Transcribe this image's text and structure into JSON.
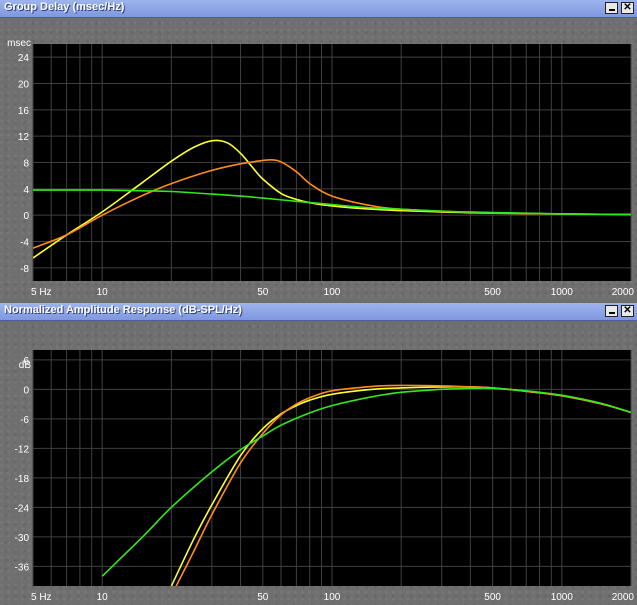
{
  "panels": [
    {
      "title": "Group Delay (msec/Hz)",
      "window_buttons": {
        "minimize_icon": "minimize-icon",
        "close_icon": "close-icon",
        "close_label": "✕"
      }
    },
    {
      "title": "Normalized Amplitude Response (dB-SPL/Hz)",
      "window_buttons": {
        "minimize_icon": "minimize-icon",
        "close_icon": "close-icon",
        "close_label": "✕"
      }
    }
  ],
  "colors": {
    "background": "#000000",
    "grid": "#404040",
    "series1": "#ffff33",
    "series2": "#ff8c1a",
    "series3": "#33e81a"
  },
  "chart_data": [
    {
      "type": "line",
      "title": "Group Delay (msec/Hz)",
      "ylabel": "msec",
      "xscale": "log",
      "xlim": [
        5,
        2000
      ],
      "ylim": [
        -10,
        26
      ],
      "x_ticks": [
        5,
        10,
        50,
        100,
        500,
        1000,
        2000
      ],
      "x_tick_labels": [
        "5 Hz",
        "10",
        "50",
        "100",
        "500",
        "1000",
        "2000"
      ],
      "y_ticks": [
        -8,
        -4,
        0,
        4,
        8,
        12,
        16,
        20,
        24
      ],
      "y_tick_labels": [
        "-8",
        "-4",
        "0",
        "4",
        "8",
        "12",
        "16",
        "20",
        "24"
      ],
      "grid": true,
      "series": [
        {
          "color": "#ffff33",
          "x": [
            5,
            7,
            10,
            15,
            20,
            25,
            30,
            35,
            40,
            45,
            50,
            60,
            70,
            80,
            100,
            150,
            200,
            300,
            500,
            1000,
            2000
          ],
          "y": [
            -6.5,
            -3,
            0.5,
            5,
            8.2,
            10.3,
            11.3,
            11,
            9.4,
            7.3,
            5.5,
            3.3,
            2.4,
            1.9,
            1.4,
            0.9,
            0.7,
            0.5,
            0.3,
            0.2,
            0.1
          ]
        },
        {
          "color": "#ff8c1a",
          "x": [
            5,
            7,
            10,
            15,
            20,
            30,
            40,
            50,
            55,
            60,
            70,
            80,
            100,
            150,
            200,
            300,
            500,
            1000,
            2000
          ],
          "y": [
            -5,
            -3,
            0,
            3,
            4.8,
            6.8,
            7.8,
            8.3,
            8.4,
            8.1,
            6.6,
            4.8,
            2.9,
            1.4,
            0.9,
            0.6,
            0.3,
            0.2,
            0.1
          ]
        },
        {
          "color": "#33e81a",
          "x": [
            5,
            10,
            15,
            20,
            30,
            40,
            50,
            70,
            100,
            150,
            200,
            300,
            500,
            1000,
            2000
          ],
          "y": [
            3.8,
            3.8,
            3.7,
            3.6,
            3.2,
            2.9,
            2.6,
            2.1,
            1.6,
            1.1,
            0.9,
            0.6,
            0.4,
            0.2,
            0.1
          ]
        }
      ]
    },
    {
      "type": "line",
      "title": "Normalized Amplitude Response (dB-SPL/Hz)",
      "ylabel": "dB",
      "xscale": "log",
      "xlim": [
        5,
        2000
      ],
      "ylim": [
        -40,
        8
      ],
      "x_ticks": [
        5,
        10,
        50,
        100,
        500,
        1000,
        2000
      ],
      "x_tick_labels": [
        "5 Hz",
        "10",
        "50",
        "100",
        "500",
        "1000",
        "2000"
      ],
      "y_ticks": [
        -36,
        -30,
        -24,
        -18,
        -12,
        -6,
        0,
        6
      ],
      "y_tick_labels": [
        "-36",
        "-30",
        "-24",
        "-18",
        "-12",
        "-6",
        "0",
        "6"
      ],
      "grid": true,
      "series": [
        {
          "color": "#ffff33",
          "x": [
            20,
            25,
            30,
            40,
            50,
            60,
            70,
            80,
            100,
            150,
            200,
            300,
            400,
            500,
            700,
            1000,
            1500,
            2000
          ],
          "y": [
            -40,
            -30.5,
            -23.5,
            -13.5,
            -8,
            -5,
            -3.3,
            -2.2,
            -1,
            0,
            0.3,
            0.5,
            0.5,
            0.3,
            -0.4,
            -1.3,
            -3,
            -4.7
          ]
        },
        {
          "color": "#ff8c1a",
          "x": [
            21,
            25,
            30,
            40,
            50,
            60,
            70,
            80,
            100,
            150,
            200,
            300,
            400,
            500,
            700,
            1000,
            1500,
            2000
          ],
          "y": [
            -40,
            -33,
            -25.5,
            -15,
            -9,
            -5.2,
            -3,
            -1.7,
            -0.3,
            0.6,
            0.8,
            0.7,
            0.5,
            0.3,
            -0.4,
            -1.3,
            -3,
            -4.7
          ]
        },
        {
          "color": "#33e81a",
          "x": [
            10,
            15,
            20,
            30,
            40,
            50,
            60,
            80,
            100,
            150,
            200,
            300,
            400,
            500,
            700,
            1000,
            1500,
            2000
          ],
          "y": [
            -38,
            -30,
            -24,
            -16.8,
            -12.3,
            -9.5,
            -7.3,
            -4.8,
            -3.3,
            -1.5,
            -0.6,
            0,
            0.2,
            0.2,
            -0.3,
            -1.2,
            -2.9,
            -4.7
          ]
        }
      ]
    }
  ]
}
